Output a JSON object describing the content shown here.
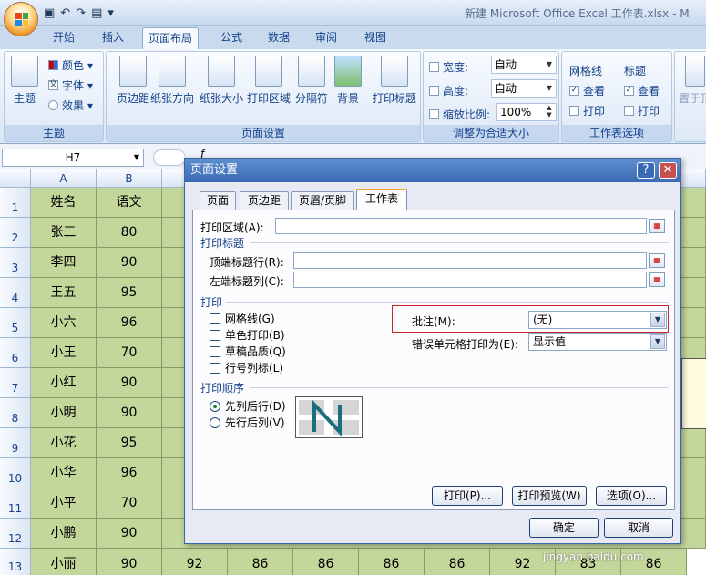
{
  "app": {
    "window_title": "新建 Microsoft Office Excel 工作表.xlsx - M",
    "qat_icons": [
      "save-icon",
      "undo-icon",
      "redo-icon",
      "print-preview-icon",
      "customize-icon"
    ]
  },
  "ribbon": {
    "tabs": [
      "开始",
      "插入",
      "页面布局",
      "公式",
      "数据",
      "审阅",
      "视图"
    ],
    "active_tab": "页面布局",
    "theme_group": {
      "label": "主题",
      "theme_btn": "主题",
      "colors": "颜色",
      "fonts": "字体",
      "effects": "效果"
    },
    "page_setup_group": {
      "label": "页面设置",
      "buttons": [
        "页边距",
        "纸张方向",
        "纸张大小",
        "打印区域",
        "分隔符",
        "背景",
        "打印标题"
      ]
    },
    "scale_group": {
      "label": "调整为合适大小",
      "width_label": "宽度:",
      "width_value": "自动",
      "height_label": "高度:",
      "height_value": "自动",
      "scale_label": "缩放比例:",
      "scale_value": "100%"
    },
    "sheet_options_group": {
      "label": "工作表选项",
      "gridlines": "网格线",
      "headings": "标题",
      "view": "查看",
      "print": "打印"
    },
    "arrange_partial": "置于顶"
  },
  "formula_bar": {
    "name_box": "H7",
    "fx": "f"
  },
  "sheet": {
    "columns": [
      "A",
      "B"
    ],
    "rows": [
      {
        "n": "1",
        "a": "姓名",
        "b": "语文"
      },
      {
        "n": "2",
        "a": "张三",
        "b": "80"
      },
      {
        "n": "3",
        "a": "李四",
        "b": "90"
      },
      {
        "n": "4",
        "a": "王五",
        "b": "95"
      },
      {
        "n": "5",
        "a": "小六",
        "b": "96"
      },
      {
        "n": "6",
        "a": "小王",
        "b": "70"
      },
      {
        "n": "7",
        "a": "小红",
        "b": "90"
      },
      {
        "n": "8",
        "a": "小明",
        "b": "90"
      },
      {
        "n": "9",
        "a": "小花",
        "b": "95"
      },
      {
        "n": "10",
        "a": "小华",
        "b": "96"
      },
      {
        "n": "11",
        "a": "小平",
        "b": "70"
      },
      {
        "n": "12",
        "a": "小鹏",
        "b": "90"
      }
    ],
    "row13": {
      "n": "13",
      "cells": [
        "小丽",
        "90",
        "92",
        "86",
        "86",
        "86",
        "86",
        "92",
        "83",
        "86"
      ]
    }
  },
  "dialog": {
    "title": "页面设置",
    "help": "?",
    "close": "✕",
    "tabs": [
      "页面",
      "页边距",
      "页眉/页脚",
      "工作表"
    ],
    "active_tab": "工作表",
    "print_area_label": "打印区域(A):",
    "print_titles_section": "打印标题",
    "top_rows_label": "顶端标题行(R):",
    "left_cols_label": "左端标题列(C):",
    "print_section": "打印",
    "checkboxes": [
      "网格线(G)",
      "单色打印(B)",
      "草稿品质(Q)",
      "行号列标(L)"
    ],
    "comments_label": "批注(M):",
    "comments_value": "(无)",
    "errors_label": "错误单元格打印为(E):",
    "errors_value": "显示值",
    "order_section": "打印顺序",
    "order_options": [
      "先列后行(D)",
      "先行后列(V)"
    ],
    "buttons": {
      "print": "打印(P)...",
      "preview": "打印预览(W)",
      "options": "选项(O)...",
      "ok": "确定",
      "cancel": "取消"
    }
  },
  "watermark": "jingyan.baidu.com",
  "colors": {
    "cell_fill": "#c4d79b",
    "dialog_title": "#3a6ab3",
    "highlight": "#c8262a"
  }
}
